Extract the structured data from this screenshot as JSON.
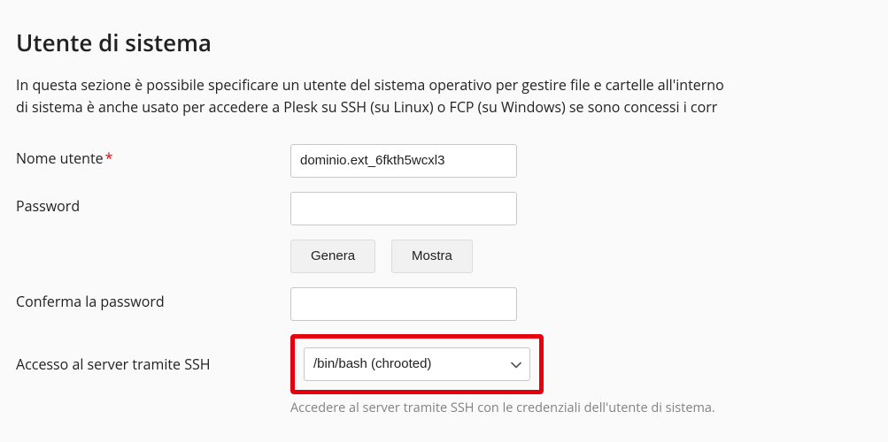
{
  "section": {
    "title": "Utente di sistema",
    "desc_line1": "In questa sezione è possibile specificare un utente del sistema operativo per gestire file e cartelle all'interno",
    "desc_line2": "di sistema è anche usato per accedere a Plesk su SSH (su Linux) o FCP (su Windows) se sono concessi i corr"
  },
  "fields": {
    "username_label": "Nome utente",
    "username_value": "dominio.ext_6fkth5wcxl3",
    "password_label": "Password",
    "password_value": "",
    "generate_btn": "Genera",
    "show_btn": "Mostra",
    "confirm_label": "Conferma la password",
    "confirm_value": "",
    "ssh_label": "Accesso al server tramite SSH",
    "ssh_selected": "/bin/bash (chrooted)",
    "ssh_hint": "Accedere al server tramite SSH con le credenziali dell'utente di sistema."
  }
}
